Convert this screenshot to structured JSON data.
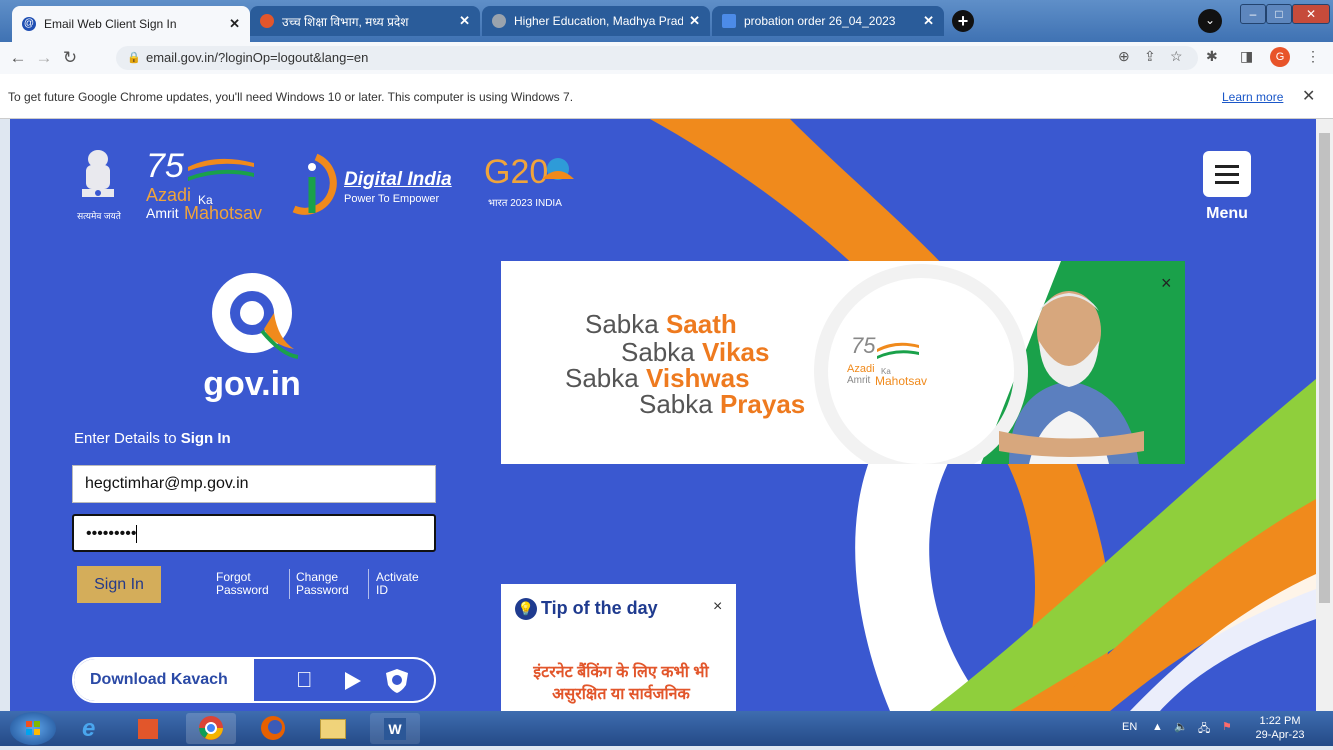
{
  "browser": {
    "tabs": [
      {
        "title": "Email Web Client Sign In",
        "active": true
      },
      {
        "title": "उच्च शिक्षा विभाग, मध्य प्रदेश",
        "active": false
      },
      {
        "title": "Higher Education, Madhya Prade",
        "active": false
      },
      {
        "title": "probation order 26_04_2023",
        "active": false
      }
    ],
    "url": "email.gov.in/?loginOp=logout&lang=en",
    "profile_initial": "G"
  },
  "infobar": {
    "message": "To get future Google Chrome updates, you'll need Windows 10 or later. This computer is using Windows 7.",
    "learn_more": "Learn more"
  },
  "header": {
    "emblem_caption": "सत्यमेव जयते",
    "azadi": {
      "number": "75",
      "line1": "Azadi",
      "ka": "Ka",
      "line2a": "Amrit",
      "line2b": "Mahotsav"
    },
    "digital_india": {
      "title": "Digital India",
      "tagline": "Power To Empower"
    },
    "g20": {
      "title": "G20",
      "caption": "भारत 2023 INDIA"
    },
    "menu_label": "Menu"
  },
  "login": {
    "brand": "gov.in",
    "enter_prefix": "Enter Details to",
    "enter_bold": "Sign In",
    "username": "hegctimhar@mp.gov.in",
    "password_mask": "•••••••••",
    "sign_in": "Sign In",
    "links": {
      "forgot_1": "Forgot",
      "forgot_2": "Password",
      "change_1": "Change",
      "change_2": "Password",
      "activate_1": "Activate",
      "activate_2": "ID"
    },
    "download_kavach": "Download Kavach"
  },
  "banner": {
    "lines": [
      {
        "plain": "Sabka",
        "bold": "Saath"
      },
      {
        "plain": "Sabka",
        "bold": "Vikas"
      },
      {
        "plain": "Sabka",
        "bold": "Vishwas"
      },
      {
        "plain": "Sabka",
        "bold": "Prayas"
      }
    ],
    "azadi": {
      "line1": "Azadi",
      "ka": "Ka",
      "line2a": "Amrit",
      "line2b": "Mahotsav"
    },
    "close": "×"
  },
  "tip": {
    "title": "Tip of the day",
    "close": "×",
    "body": "इंटरनेट बैंकिंग के लिए कभी भी असुरक्षित या सार्वजनिक"
  },
  "taskbar": {
    "lang": "EN",
    "time": "1:22 PM",
    "date": "29-Apr-23"
  },
  "colors": {
    "page_bg": "#3a58d0",
    "saffron": "#ee7a1f",
    "green": "#1aa14a",
    "sign_in_btn": "#d4ad5a"
  }
}
